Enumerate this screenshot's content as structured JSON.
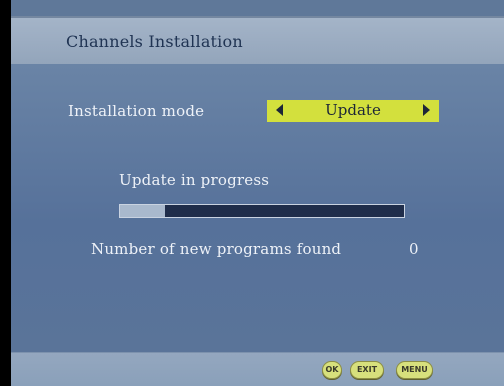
{
  "header": {
    "title": "Channels Installation"
  },
  "installation": {
    "mode_label": "Installation mode",
    "mode_value": "Update"
  },
  "progress": {
    "label": "Update in progress",
    "fraction": 0.16
  },
  "results": {
    "label": "Number of new programs found",
    "value": "0"
  },
  "footer": {
    "buttons": [
      {
        "label": "OK",
        "icon": "ok-button"
      },
      {
        "label": "EXIT",
        "icon": "exit-button"
      },
      {
        "label": "MENU",
        "icon": "menu-button"
      }
    ]
  },
  "colors": {
    "background": "#5f7899",
    "title_bar": "#a4b4c8",
    "selector_highlight": "#d3e03d",
    "progress_track": "#1f2d4a",
    "progress_fill": "#a9b9cd",
    "button": "#d7e07c"
  }
}
